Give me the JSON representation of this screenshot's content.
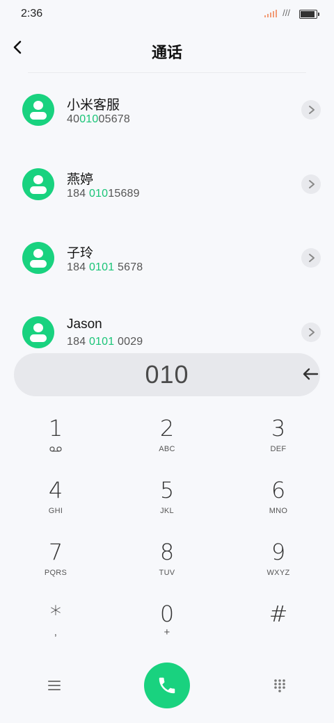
{
  "status_bar": {
    "time": "2:36"
  },
  "header": {
    "title": "通话"
  },
  "contacts": [
    {
      "name": "小米客服",
      "number_pre": "40",
      "number_match": "010",
      "number_post": "05678"
    },
    {
      "name": "燕婷",
      "number_pre": "184 ",
      "number_match": "010",
      "number_post": "15689"
    },
    {
      "name": "子玲",
      "number_pre": "184 ",
      "number_match": "0101",
      "number_post": " 5678"
    },
    {
      "name": "Jason",
      "number_pre": "184 ",
      "number_match": "0101",
      "number_post": " 0029"
    }
  ],
  "input": {
    "value": "010"
  },
  "keypad": [
    {
      "digit": "1",
      "letters": ""
    },
    {
      "digit": "2",
      "letters": "ABC"
    },
    {
      "digit": "3",
      "letters": "DEF"
    },
    {
      "digit": "4",
      "letters": "GHI"
    },
    {
      "digit": "5",
      "letters": "JKL"
    },
    {
      "digit": "6",
      "letters": "MNO"
    },
    {
      "digit": "7",
      "letters": "PQRS"
    },
    {
      "digit": "8",
      "letters": "TUV"
    },
    {
      "digit": "9",
      "letters": "WXYZ"
    },
    {
      "digit": "*",
      "letters": ","
    },
    {
      "digit": "0",
      "letters": "+"
    },
    {
      "digit": "#",
      "letters": ""
    }
  ],
  "colors": {
    "accent": "#19d27f",
    "background": "#f7f8fb",
    "pill": "#e7e8ec"
  }
}
